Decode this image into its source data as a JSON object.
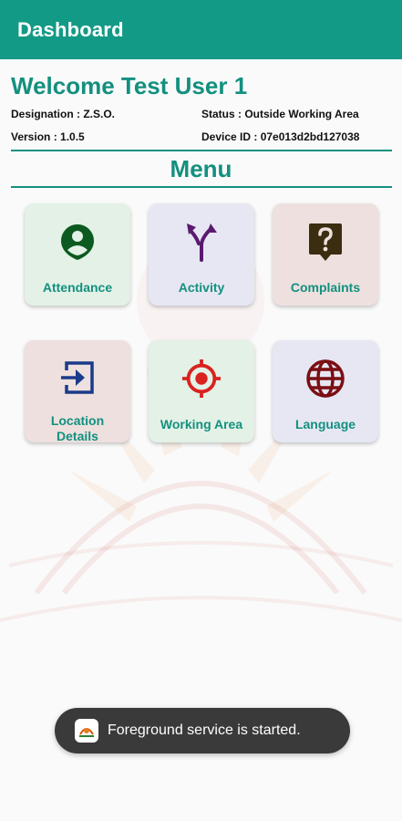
{
  "appbar": {
    "title": "Dashboard"
  },
  "header": {
    "welcome": "Welcome Test User 1",
    "designation": "Designation : Z.S.O.",
    "status": "Status : Outside Working Area",
    "version": "Version : 1.0.5",
    "device_id": "Device ID : 07e013d2bd127038"
  },
  "menu": {
    "title": "Menu",
    "items": [
      {
        "label": "Attendance",
        "icon": "person-pin-icon"
      },
      {
        "label": "Activity",
        "icon": "merge-arrows-icon"
      },
      {
        "label": "Complaints",
        "icon": "question-bubble-icon"
      },
      {
        "label": "Location Details",
        "icon": "login-box-icon"
      },
      {
        "label": "Working Area",
        "icon": "target-icon"
      },
      {
        "label": "Language",
        "icon": "globe-icon"
      }
    ]
  },
  "toast": {
    "text": "Foreground service is started."
  },
  "colors": {
    "primary": "#139a86",
    "accent_text": "#13907f",
    "tile_green": "#e3f1e6",
    "tile_lavender": "#e6e7f3",
    "tile_rose": "#ede0de"
  }
}
